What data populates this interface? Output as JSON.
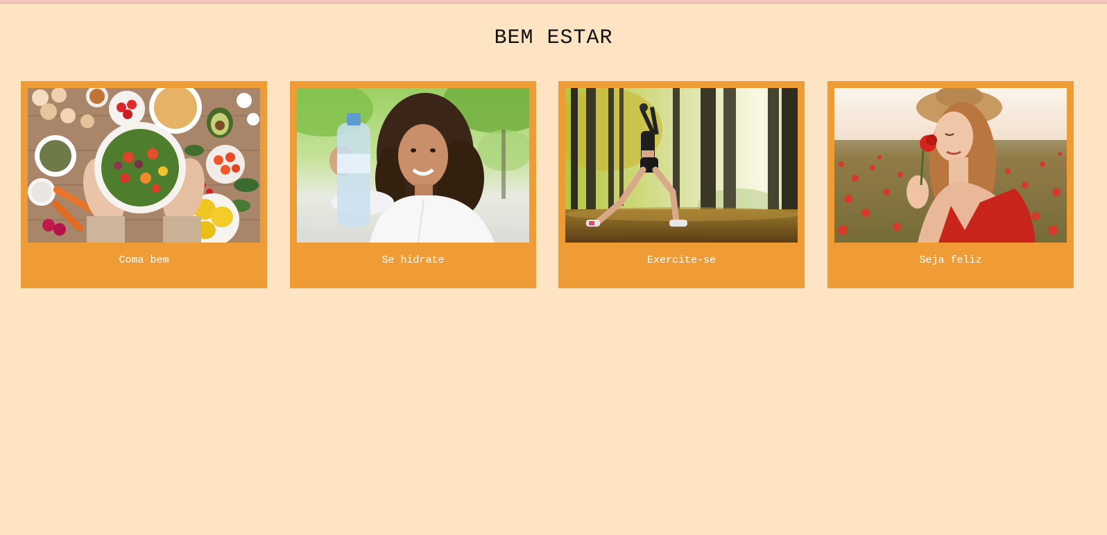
{
  "page": {
    "title": "BEM ESTAR",
    "background": "#ffe4c4",
    "card_color": "#ef9b36"
  },
  "cards": [
    {
      "caption": "Coma bem",
      "image": "healthy-food-bowl-photo"
    },
    {
      "caption": "Se hidrate",
      "image": "woman-holding-water-bottle-photo"
    },
    {
      "caption": "Exercite-se",
      "image": "woman-exercising-in-forest-photo"
    },
    {
      "caption": "Seja feliz",
      "image": "woman-smelling-red-flower-photo"
    }
  ]
}
